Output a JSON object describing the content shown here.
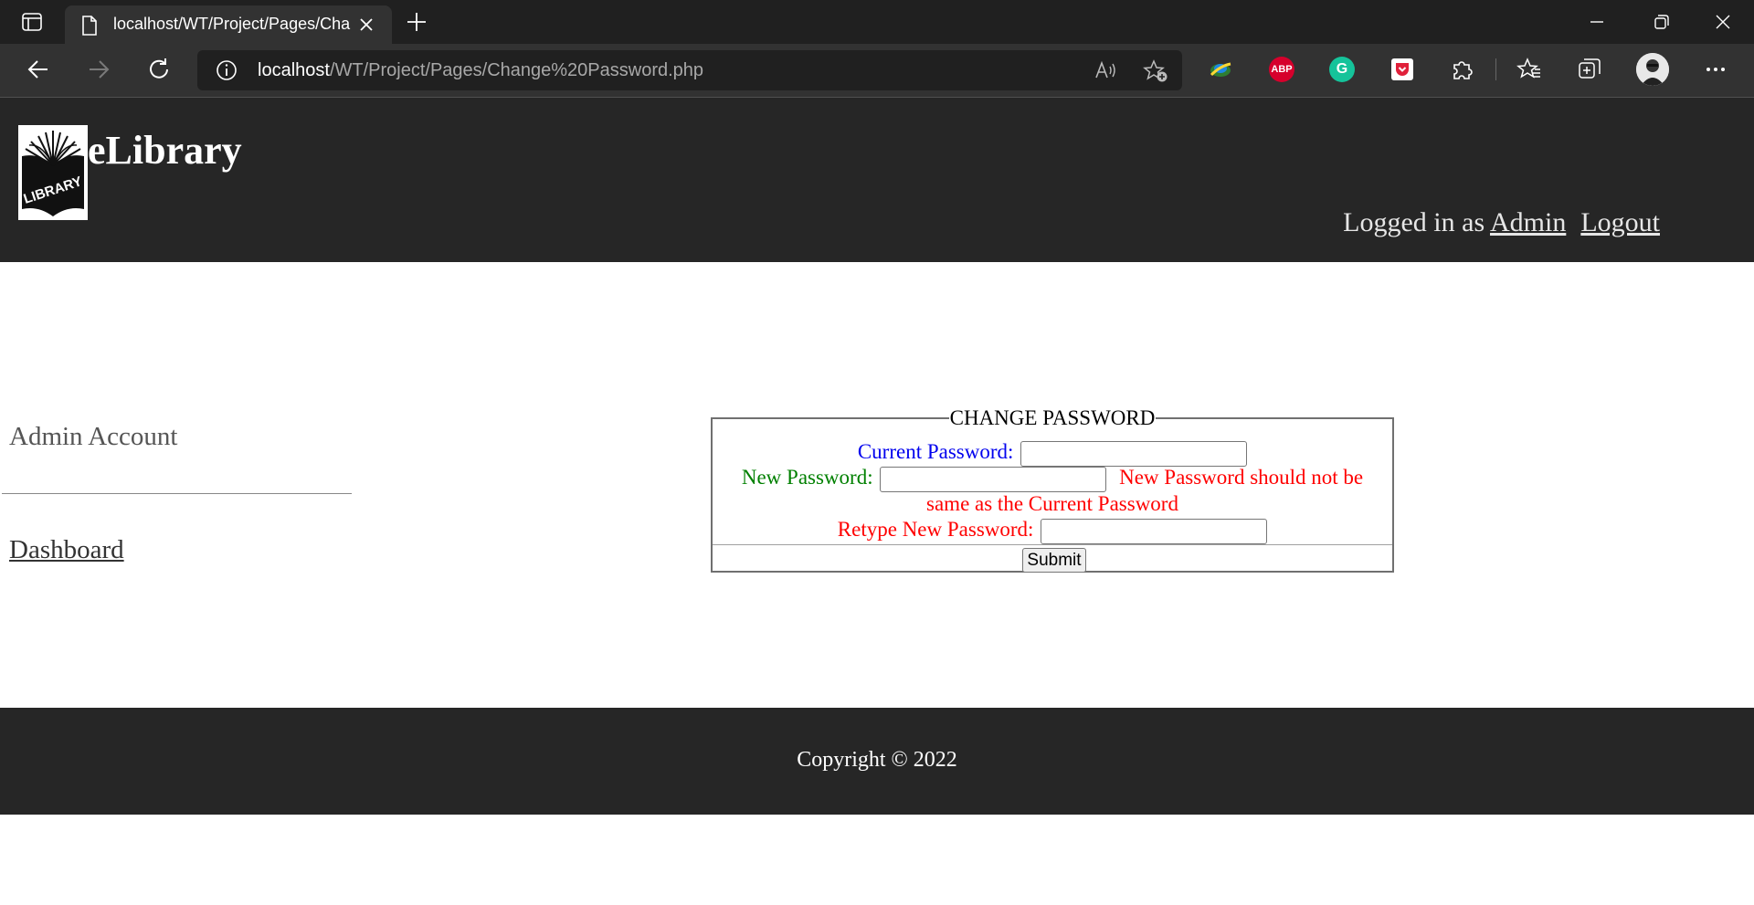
{
  "browser": {
    "tab_title": "localhost/WT/Project/Pages/Change%20Password.php",
    "url_host": "localhost",
    "url_path": "/WT/Project/Pages/Change%20Password.php",
    "icons": [
      "tab-actions-icon",
      "page-icon",
      "close-icon",
      "plus-icon",
      "minimize-icon",
      "restore-icon",
      "close-window-icon",
      "back-icon",
      "forward-icon",
      "refresh-icon",
      "info-icon",
      "read-aloud-icon",
      "add-favorite-icon",
      "extension-icon",
      "abp-icon",
      "grammarly-icon",
      "pocket-icon",
      "puzzle-icon",
      "favorites-icon",
      "collections-icon",
      "profile-icon",
      "more-icon"
    ],
    "abp_label": "ABP",
    "grammarly_label": "G"
  },
  "header": {
    "logo_text": "LIBRARY",
    "site_name": "eLibrary",
    "logged_in_prefix": "Logged in as",
    "user_link": "Admin",
    "logout_link": "Logout"
  },
  "sidebar": {
    "title": "Admin Account",
    "links": [
      "Dashboard"
    ]
  },
  "form": {
    "legend": "CHANGE PASSWORD",
    "current_label": "Current Password:",
    "current_value": "",
    "new_label": "New Password:",
    "new_value": "",
    "new_error_line1": "New Password should not be",
    "new_error_line2": "same as the Current Password",
    "retype_label": "Retype New Password:",
    "retype_value": "",
    "submit_label": "Submit"
  },
  "footer": {
    "copyright": "Copyright © 2022"
  },
  "colors": {
    "header_bg": "#262626",
    "current_label": "#0000ee",
    "new_label": "#008000",
    "error": "#ff0000"
  }
}
